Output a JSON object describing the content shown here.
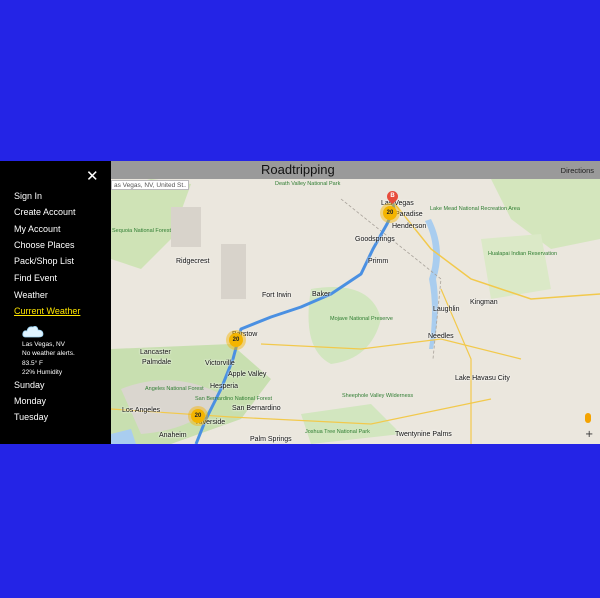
{
  "app": {
    "title": "Roadtripping",
    "directions_label": "Directions",
    "close_glyph": "✕"
  },
  "sidebar": {
    "items": [
      {
        "label": "Sign In"
      },
      {
        "label": "Create Account"
      },
      {
        "label": "My Account"
      },
      {
        "label": "Choose Places"
      },
      {
        "label": "Pack/Shop List"
      },
      {
        "label": "Find Event"
      },
      {
        "label": "Weather"
      },
      {
        "label": "Current Weather",
        "active": true
      }
    ],
    "weather": {
      "icon": "cloud-icon",
      "location": "Las Vegas, NV",
      "alerts": "No weather alerts.",
      "temperature": "83.5° F",
      "humidity": "22% Humidity"
    },
    "forecast_days": [
      {
        "label": "Sunday"
      },
      {
        "label": "Monday"
      },
      {
        "label": "Tuesday"
      }
    ]
  },
  "map": {
    "search_value": "as Vegas, NV, United St...",
    "end_marker_label": "B",
    "clusters": [
      {
        "count": "20"
      },
      {
        "count": "20"
      },
      {
        "count": "20"
      }
    ],
    "cities": [
      "Las Vegas",
      "Paradise",
      "Henderson",
      "Goodsprings",
      "Primm",
      "Baker",
      "Barstow",
      "Victorville",
      "Hesperia",
      "Apple Valley",
      "Lancaster",
      "Palmdale",
      "Los Angeles",
      "Anaheim",
      "Riverside",
      "San Bernardino",
      "Palm Springs",
      "Needles",
      "Kingman",
      "Lake Havasu City",
      "Fort Irwin",
      "Ridgecrest",
      "Twentynine Palms",
      "Laughlin"
    ],
    "parks": [
      "Death Valley National Park",
      "Lake Mead National Recreation Area",
      "Mojave National Preserve",
      "Joshua Tree National Park",
      "Sequoia National Forest",
      "San Bernardino National Forest",
      "Angeles National Forest",
      "Hualapai Indian Reservation",
      "Sheephole Valley Wilderness"
    ],
    "route_color": "#4a90e2",
    "cluster_color": "#f4b400",
    "controls": {
      "zoom_in": "+"
    }
  }
}
